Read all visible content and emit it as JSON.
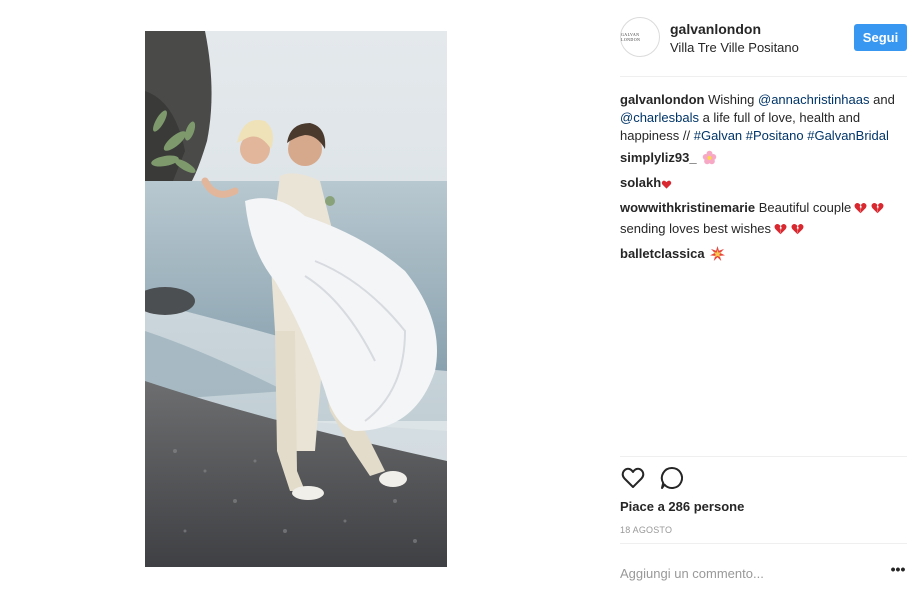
{
  "post": {
    "image_alt": "wedding photo on beach"
  },
  "header": {
    "avatar_text": "GALVAN LONDON",
    "username": "galvanlondon",
    "location": "Villa Tre Ville Positano",
    "follow_label": "Segui"
  },
  "caption": {
    "user": "galvanlondon",
    "text_1": "Wishing",
    "mention_1": "@annachristinhaas",
    "text_2": "and",
    "mention_2": "@charlesbals",
    "text_3": "a life full of love, health and happiness //",
    "tag_1": "#Galvan",
    "tag_2": "#Positano",
    "tag_3": "#GalvanBridal"
  },
  "comments": [
    {
      "user": "simplyliz93_",
      "text": "",
      "emoji": "flower-emoji"
    },
    {
      "user": "solakh",
      "text": "",
      "emoji": "heart-emoji"
    },
    {
      "user": "wowwithkristinemarie",
      "text": "Beautiful couple",
      "text_2": "sending loves best wishes",
      "emoji": "broken-heart-emoji"
    },
    {
      "user": "balletclassica",
      "text": "",
      "emoji": "collision-emoji"
    }
  ],
  "actions": {
    "like_icon": "heart-outline-icon",
    "comment_icon": "speech-bubble-icon"
  },
  "likes_text": "Piace a 286 persone",
  "date_text": "18 AGOSTO",
  "comment_input": {
    "placeholder": "Aggiungi un commento...",
    "value": ""
  },
  "more_label": "•••",
  "colors": {
    "follow_button": "#3897f0",
    "link": "#003569",
    "muted": "#999999",
    "divider": "#efefef"
  }
}
